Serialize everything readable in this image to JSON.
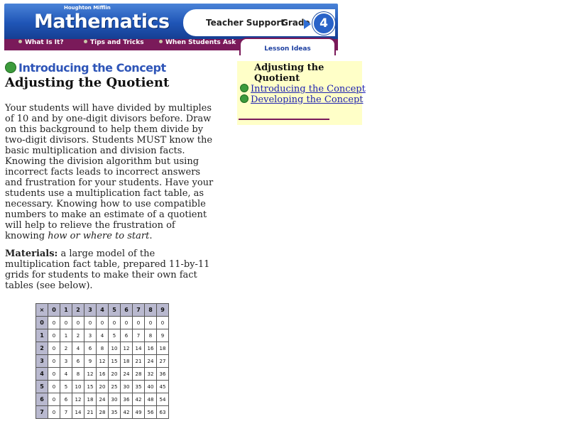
{
  "header": {
    "publisher": "Houghton Mifflin",
    "title": "Mathematics",
    "support": "Teacher Support",
    "grade_label": "Grade",
    "grade_number": "4"
  },
  "nav": {
    "items": [
      "What Is It?",
      "Tips and Tricks",
      "When Students Ask"
    ],
    "active_tab": "Lesson Ideas"
  },
  "sidebar": {
    "title": "Adjusting the Quotient",
    "links": [
      "Introducing the Concept",
      "Developing the Concept"
    ]
  },
  "main": {
    "section_header": "Introducing the Concept",
    "title": "Adjusting the Quotient",
    "intro_text": "Your students will have divided by multiples of 10 and by one-digit divisors before. Draw on this background to help them divide by two-digit divisors. Students MUST know the basic multiplication and division facts. Knowing the division algorithm but using incorrect facts leads to incorrect answers and frustration for your students. Have your students use a multiplication fact table, as necessary. Knowing how to use compatible numbers to make an estimate of a quotient will help to relieve the frustration of knowing",
    "intro_italic": "how or where to start",
    "intro_end": ".",
    "materials_label": "Materials:",
    "materials_text": " a large model of the multiplication fact table, prepared 11-by-11 grids for students to make their own fact tables (see below)."
  },
  "fact_table": {
    "corner": "×",
    "columns": [
      "0",
      "1",
      "2",
      "3",
      "4",
      "5",
      "6",
      "7",
      "8",
      "9"
    ],
    "rows": [
      {
        "label": "0",
        "values": [
          "0",
          "0",
          "0",
          "0",
          "0",
          "0",
          "0",
          "0",
          "0",
          "0"
        ]
      },
      {
        "label": "1",
        "values": [
          "0",
          "1",
          "2",
          "3",
          "4",
          "5",
          "6",
          "7",
          "8",
          "9"
        ]
      },
      {
        "label": "2",
        "values": [
          "0",
          "2",
          "4",
          "6",
          "8",
          "10",
          "12",
          "14",
          "16",
          "18"
        ]
      },
      {
        "label": "3",
        "values": [
          "0",
          "3",
          "6",
          "9",
          "12",
          "15",
          "18",
          "21",
          "24",
          "27"
        ]
      },
      {
        "label": "4",
        "values": [
          "0",
          "4",
          "8",
          "12",
          "16",
          "20",
          "24",
          "28",
          "32",
          "36"
        ]
      },
      {
        "label": "5",
        "values": [
          "0",
          "5",
          "10",
          "15",
          "20",
          "25",
          "30",
          "35",
          "40",
          "45"
        ]
      },
      {
        "label": "6",
        "values": [
          "0",
          "6",
          "12",
          "18",
          "24",
          "30",
          "36",
          "42",
          "48",
          "54"
        ]
      },
      {
        "label": "7",
        "values": [
          "0",
          "7",
          "14",
          "21",
          "28",
          "35",
          "42",
          "49",
          "56",
          "63"
        ]
      }
    ]
  },
  "colors": {
    "banner_blue": "#1f55b6",
    "nav_maroon": "#7a1a5a",
    "link_blue": "#1f23b0",
    "sidebar_bg": "#ffffc8",
    "bullet_green": "#3c9b3c",
    "table_header": "#b9b9cf"
  }
}
